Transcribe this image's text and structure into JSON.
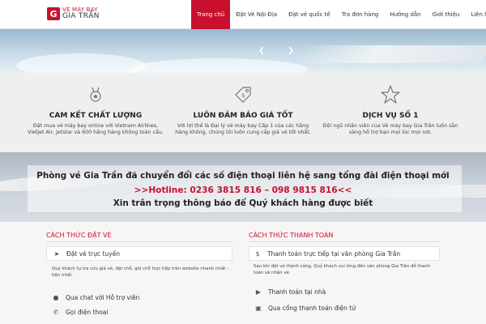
{
  "header": {
    "logo": {
      "mark": "G",
      "line1": "VÉ MÁY BAY",
      "line2": "GIA TRẦN"
    },
    "nav": [
      {
        "label": "Trang chủ",
        "active": true
      },
      {
        "label": "Đặt Vé Nội Địa",
        "active": false
      },
      {
        "label": "Đặt vé quốc tế",
        "active": false
      },
      {
        "label": "Tra đơn hàng",
        "active": false
      },
      {
        "label": "Hướng dẫn",
        "active": false
      },
      {
        "label": "Giới thiệu",
        "active": false
      },
      {
        "label": "Liên hệ",
        "active": false
      }
    ]
  },
  "hero": {
    "prev_icon": "chevron-left-icon",
    "next_icon": "chevron-right-icon"
  },
  "features": [
    {
      "icon": "medal-icon",
      "title": "CAM KẾT CHẤT LƯỢNG",
      "desc": "Đặt mua vé máy bay online với Vietnam Airlines, Vietjet Air, Jetstar và 600 hãng hàng không toàn cầu."
    },
    {
      "icon": "price-tag-icon",
      "title": "LUÔN ĐẢM BẢO GIÁ TỐT",
      "desc": "Với lợi thế là Đại lý vé máy bay Cấp 1 của các hãng hàng không, chúng tôi luôn cung cấp giá vé tốt nhất."
    },
    {
      "icon": "star-icon",
      "title": "DỊCH VỤ SỐ 1",
      "desc": "Đội ngũ nhân viên của Vé máy bay Gia Trần luôn sẵn sàng hỗ trợ bạn mọi lúc mọi nơi."
    }
  ],
  "notice": {
    "line1": "Phòng vé Gia Trần đã chuyển đổi các số điện thoại liên hệ sang tổng đài điện thoại mới",
    "line2": ">>Hotline: 0236 3815 816 – 098 9815 816<<",
    "line3": "Xin trân trọng thông báo để Quý khách hàng được biết"
  },
  "booking": {
    "title": "CÁCH THỨC ĐẶT VÉ",
    "items": [
      {
        "icon": "paper-plane-icon",
        "label": "Đặt vé trực tuyến"
      },
      {
        "icon": "chat-icon",
        "label": "Qua chat với Hỗ trợ viên"
      },
      {
        "icon": "phone-icon",
        "label": "Gọi điện thoại"
      }
    ],
    "desc": "Quý khách tự tra cứu giá vé, đặt chỗ, giữ chỗ trực tiếp trên website nhanh nhất – tiện nhất."
  },
  "payment": {
    "title": "CÁCH THỨC THANH TOÁN",
    "items": [
      {
        "icon": "dollar-icon",
        "label": "Thanh toán trực tiếp tại văn phòng Gia Trần"
      },
      {
        "icon": "truck-icon",
        "label": "Thanh toán tại nhà"
      },
      {
        "icon": "card-icon",
        "label": "Qua cổng thanh toán điện tử"
      }
    ],
    "desc": "Sau khi đặt vé thành công, Quý khách vui lòng đến văn phòng Gia Trần để thanh toán và nhận vé."
  }
}
